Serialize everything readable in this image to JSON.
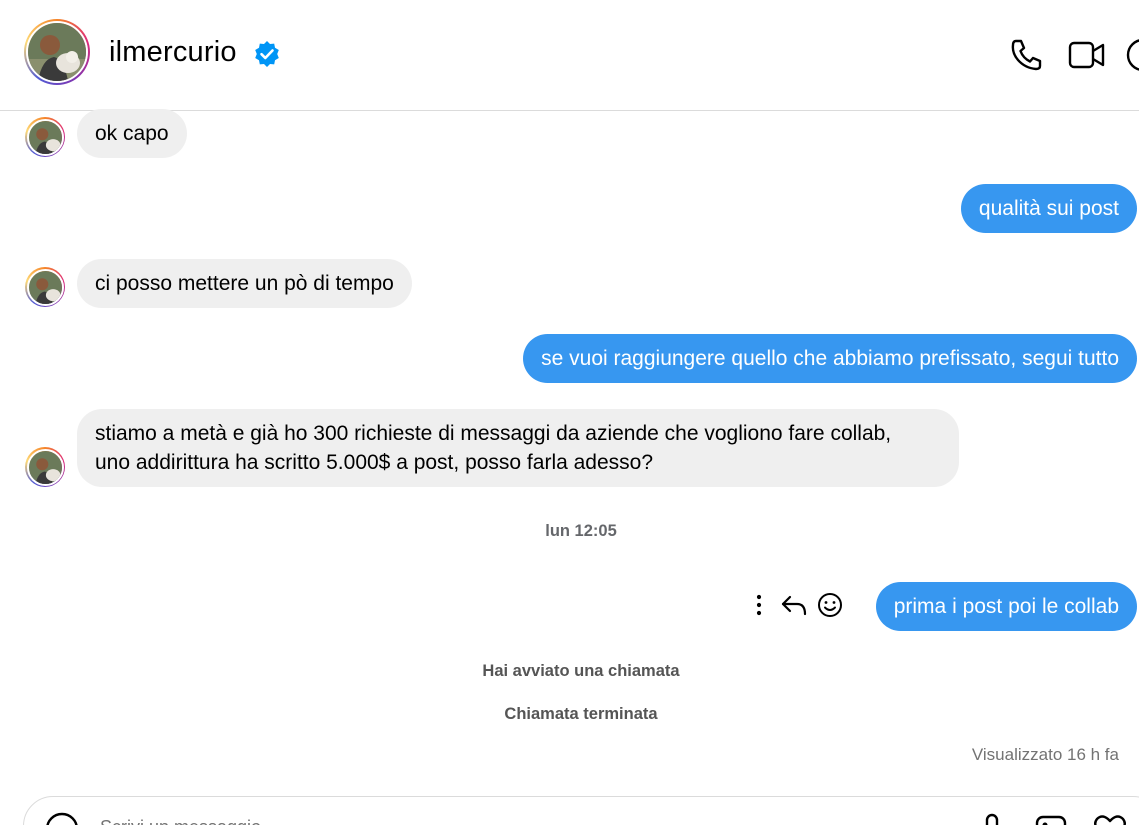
{
  "header": {
    "username": "ilmercurio",
    "verified_color": "#0095f6"
  },
  "messages": [
    {
      "side": "in",
      "text": "ok capo"
    },
    {
      "side": "out",
      "text": "qualità sui post"
    },
    {
      "side": "in",
      "text": "ci posso mettere un pò di tempo"
    },
    {
      "side": "out",
      "text": "se vuoi raggiungere quello che abbiamo prefissato, segui tutto"
    },
    {
      "side": "in",
      "line1": "stiamo a metà e già ho 300 richieste di messaggi da aziende che vogliono fare collab,",
      "line2": "uno addirittura ha scritto 5.000$ a post, posso farla adesso?"
    },
    {
      "side": "out",
      "text": "prima i post poi le collab"
    }
  ],
  "timestamp": "lun 12:05",
  "call_events": [
    "Hai avviato una chiamata",
    "Chiamata terminata"
  ],
  "seen_status": "Visualizzato 16 h fa",
  "composer": {
    "placeholder": "Scrivi un messaggio..."
  },
  "colors": {
    "outgoing_bubble": "#3797f0",
    "incoming_bubble": "#efefef"
  }
}
